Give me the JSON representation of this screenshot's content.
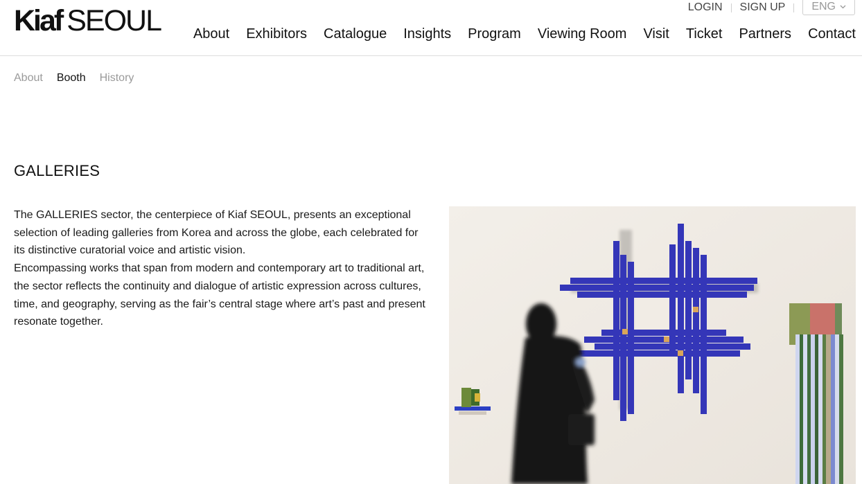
{
  "header": {
    "logo_bold": "Kiaf",
    "logo_regular": "SEOUL",
    "util": {
      "login": "LOGIN",
      "signup": "SIGN UP",
      "lang": "ENG"
    },
    "nav": [
      "About",
      "Exhibitors",
      "Catalogue",
      "Insights",
      "Program",
      "Viewing Room",
      "Visit",
      "Ticket",
      "Partners",
      "Contact"
    ]
  },
  "subtabs": [
    {
      "label": "About",
      "active": false
    },
    {
      "label": "Booth",
      "active": true
    },
    {
      "label": "History",
      "active": false
    }
  ],
  "section": {
    "title": "GALLERIES",
    "paragraph1": "The GALLERIES sector, the centerpiece of Kiaf SEOUL, presents an exceptional selection of leading galleries from Korea and across the globe, each celebrated for its distinctive curatorial voice and artistic vision.",
    "paragraph2": "Encompassing works that span from modern and contemporary art to traditional art, the sector reflects the continuity and dialogue of artistic expression across cultures, time, and geography, serving as the fair’s central stage where art’s past and present resonate together."
  },
  "colors": {
    "accent_blue": "#3436b8",
    "text": "#111111",
    "muted": "#9a9a9a"
  }
}
